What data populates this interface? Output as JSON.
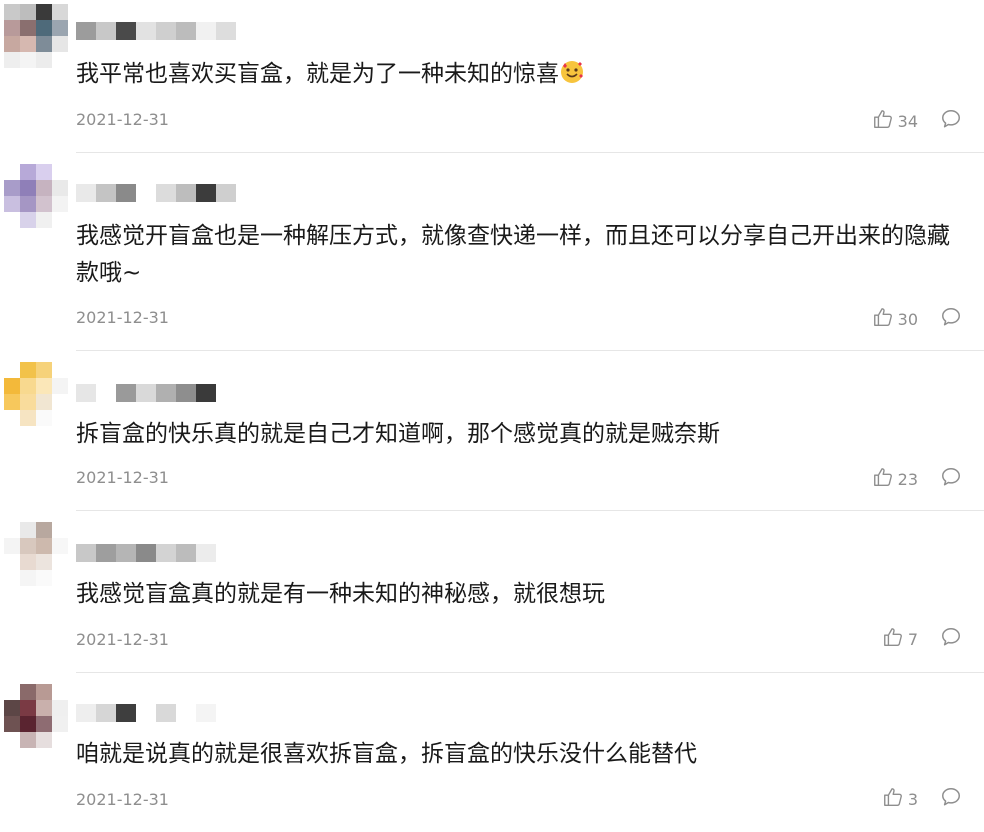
{
  "comments": [
    {
      "text": "我平常也喜欢买盲盒，就是为了一种未知的惊喜",
      "emoji": "face-with-hearts",
      "date": "2021-12-31",
      "likes": "34",
      "avatar_colors": [
        "#c9c9c9",
        "#bdbdbd",
        "#3a3a3a",
        "#d8d8d8",
        "#b89a9a",
        "#8a6f6f",
        "#4e6a7a",
        "#9aa5b0",
        "#c7a8a0",
        "#d6b8b0",
        "#7e8c98",
        "#e6e6e6",
        "#eeeeee",
        "#f4f4f4",
        "#ececec",
        "#ffffff"
      ],
      "username_colors": [
        "#9c9c9c",
        "#c8c8c8",
        "#4a4a4a",
        "#e2e2e2",
        "#cfcfcf",
        "#bcbcbc",
        "#f1f1f1",
        "#dddddd"
      ]
    },
    {
      "text": "我感觉开盲盒也是一种解压方式，就像查快递一样，而且还可以分享自己开出来的隐藏款哦~",
      "date": "2021-12-31",
      "likes": "30",
      "avatar_colors": [
        "#ffffff",
        "#b7a9d8",
        "#d9cfee",
        "#ffffff",
        "#a89cc9",
        "#8f7fb8",
        "#c6b3c0",
        "#e9e9e9",
        "#c9bfe0",
        "#a596c4",
        "#d2c2ce",
        "#f3f3f3",
        "#ffffff",
        "#d8d2ea",
        "#f0f0f0",
        "#ffffff"
      ],
      "username_colors": [
        "#e9e9e9",
        "#c4c4c4",
        "#8a8a8a",
        "#ffffff",
        "#dcdcdc",
        "#bdbdbd",
        "#3c3c3c",
        "#cfcfcf"
      ]
    },
    {
      "text": "拆盲盒的快乐真的就是自己才知道啊，那个感觉真的就是贼奈斯",
      "date": "2021-12-31",
      "likes": "23",
      "avatar_colors": [
        "#ffffff",
        "#f2c24a",
        "#f6d27a",
        "#ffffff",
        "#f3b93a",
        "#f8d98f",
        "#fbe7b8",
        "#f4f4f4",
        "#f7c85c",
        "#f9dc9c",
        "#f1e6d2",
        "#ffffff",
        "#ffffff",
        "#f6e4c2",
        "#fafafa",
        "#ffffff"
      ],
      "username_colors": [
        "#e6e6e6",
        "#ffffff",
        "#9a9a9a",
        "#d9d9d9",
        "#b0b0b0",
        "#8e8e8e",
        "#3a3a3a",
        "#ffffff"
      ]
    },
    {
      "text": "我感觉盲盒真的就是有一种未知的神秘感，就很想玩",
      "date": "2021-12-31",
      "likes": "7",
      "avatar_colors": [
        "#ffffff",
        "#e9e9e9",
        "#b8a89f",
        "#ffffff",
        "#f4f4f4",
        "#d8c8be",
        "#cdb9ad",
        "#f7f7f7",
        "#ffffff",
        "#e8dad1",
        "#ece4de",
        "#ffffff",
        "#ffffff",
        "#f5f5f5",
        "#fafafa",
        "#ffffff"
      ],
      "username_colors": [
        "#c8c8c8",
        "#9e9e9e",
        "#b5b5b5",
        "#8a8a8a",
        "#d3d3d3",
        "#bcbcbc",
        "#ececec",
        "#ffffff"
      ]
    },
    {
      "text": "咱就是说真的就是很喜欢拆盲盒，拆盲盒的快乐没什么能替代",
      "date": "2021-12-31",
      "likes": "3",
      "avatar_colors": [
        "#ffffff",
        "#8a6a6a",
        "#b89a94",
        "#ffffff",
        "#5c4646",
        "#7a3a44",
        "#c9b0ac",
        "#efefef",
        "#6e5252",
        "#5a2430",
        "#8e6c72",
        "#f0f0f0",
        "#ffffff",
        "#c8b4b4",
        "#e6dede",
        "#ffffff"
      ],
      "username_colors": [
        "#eeeeee",
        "#d6d6d6",
        "#3e3e3e",
        "#ffffff",
        "#d9d9d9",
        "#ffffff",
        "#f4f4f4",
        "#ffffff"
      ]
    }
  ]
}
